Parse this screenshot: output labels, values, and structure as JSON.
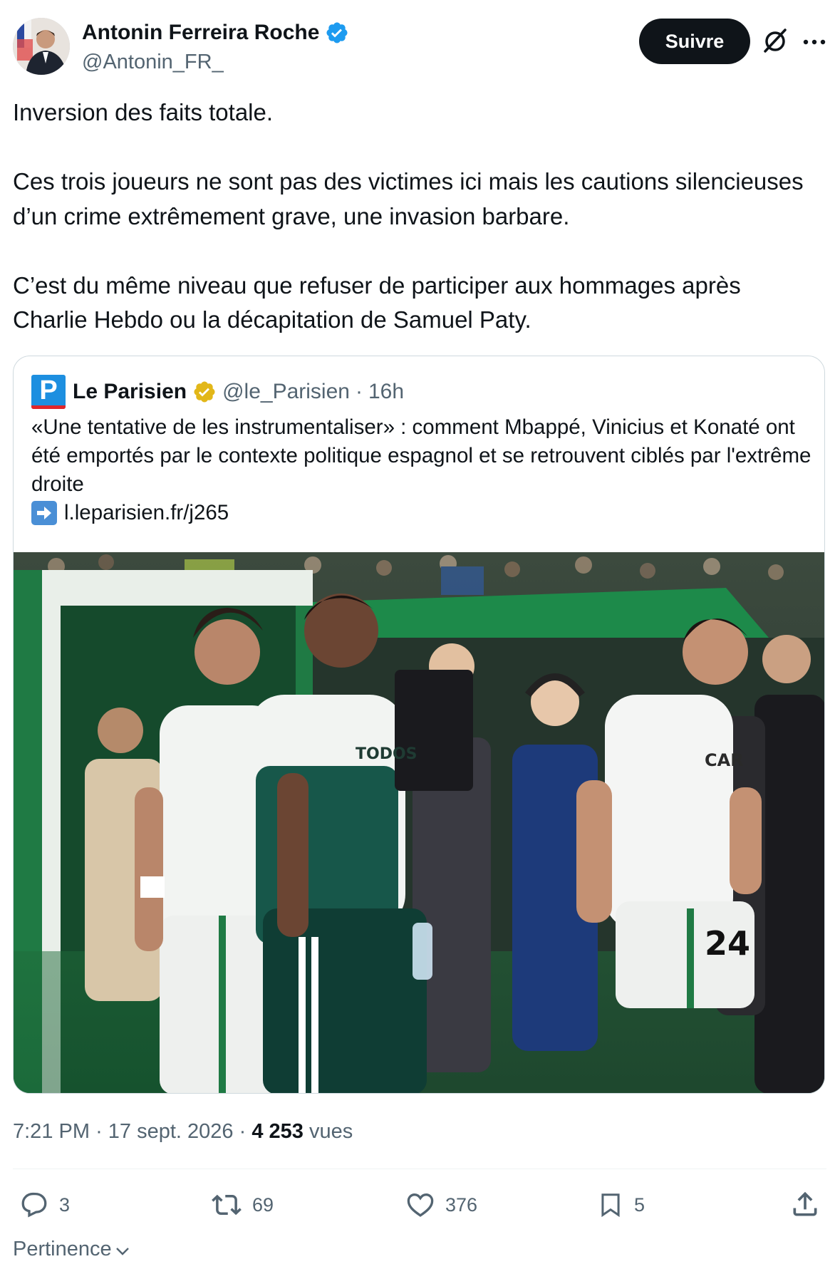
{
  "author": {
    "name": "Antonin Ferreira Roche",
    "handle": "@Antonin_FR_"
  },
  "follow_label": "Suivre",
  "tweet": {
    "paragraphs": [
      "Inversion des faits totale.",
      "Ces trois joueurs ne sont pas des victimes ici mais les cautions silencieuses d’un crime extrêmement grave, une invasion barbare.",
      "C’est du même niveau que refuser de participer aux hommages après Charlie Hebdo ou la décapitation de Samuel Paty."
    ]
  },
  "quote": {
    "logo_letter": "P",
    "name": "Le Parisien",
    "handle": "@le_Parisien",
    "separator": "·",
    "time": "16h",
    "text": "«Une tentative de les instrumentaliser» : comment Mbappé, Vinicius et Konaté ont été emportés par le contexte politique espagnol et se retrouvent ciblés par l'extrême droite",
    "link": "l.leparisien.fr/j265",
    "image": {
      "jersey_text_1": "TODOS",
      "jersey_text_2": "CAR",
      "shorts_number": "24"
    }
  },
  "meta": {
    "time": "7:21 PM",
    "sep1": "·",
    "date": "17 sept. 2026",
    "sep2": "·",
    "views_count": "4 253",
    "views_label": "vues"
  },
  "actions": {
    "replies": "3",
    "reposts": "69",
    "likes": "376",
    "bookmarks": "5"
  },
  "sort_label": "Pertinence",
  "colors": {
    "text": "#0f1419",
    "secondary": "#536471",
    "verified_blue": "#1d9bf0",
    "verified_gold": "#e2b719",
    "border": "#cfd9de"
  },
  "icons": [
    "verified-badge-icon",
    "grok-icon",
    "more-icon",
    "gold-badge-icon",
    "arrow-right-icon",
    "reply-icon",
    "repost-icon",
    "like-icon",
    "bookmark-icon",
    "share-icon",
    "chevron-down-icon"
  ]
}
